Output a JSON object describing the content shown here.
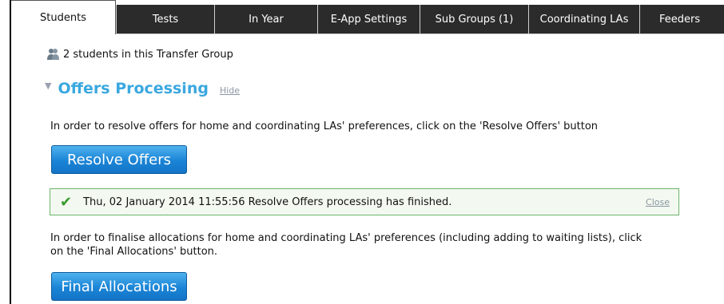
{
  "tabs": [
    {
      "label": "Students",
      "active": true
    },
    {
      "label": "Tests",
      "active": false
    },
    {
      "label": "In Year",
      "active": false
    },
    {
      "label": "E-App Settings",
      "active": false
    },
    {
      "label": "Sub Groups (1)",
      "active": false
    },
    {
      "label": "Coordinating LAs",
      "active": false
    },
    {
      "label": "Feeders",
      "active": false
    }
  ],
  "group_info": {
    "text": "2 students in this Transfer Group",
    "icon": "students-icon"
  },
  "section": {
    "title": "Offers Processing",
    "hide_label": "Hide",
    "resolve_instruction": "In order to resolve offers for home and coordinating LAs' preferences, click on the 'Resolve Offers' button",
    "resolve_button": "Resolve Offers",
    "notice": {
      "text": "Thu, 02 January 2014 11:55:56 Resolve Offers processing has finished.",
      "close_label": "Close",
      "icon": "check-icon"
    },
    "final_instruction_line1": "In order to finalise allocations for home and coordinating LAs' preferences (including adding to waiting lists), click",
    "final_instruction_line2": "on the 'Final Allocations' button.",
    "final_button": "Final Allocations"
  },
  "colors": {
    "accent": "#3aa8e0",
    "tab_bg": "#2b2b2b",
    "button": "#1a84d6",
    "notice_border": "#6bb46a"
  }
}
